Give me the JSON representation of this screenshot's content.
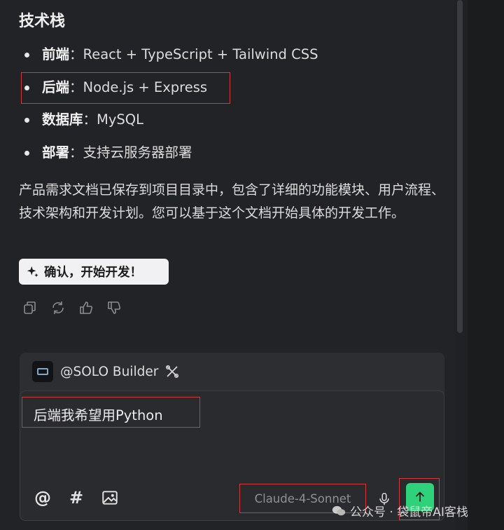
{
  "message": {
    "section_title": "技术栈",
    "tech_stack": [
      {
        "key": "前端",
        "sep": "：",
        "value": "React + TypeScript + Tailwind CSS"
      },
      {
        "key": "后端",
        "sep": "：",
        "value": "Node.js + Express"
      },
      {
        "key": "数据库",
        "sep": "：",
        "value": "MySQL"
      },
      {
        "key": "部署",
        "sep": "：",
        "value": "支持云服务器部署"
      }
    ],
    "summary": "产品需求文档已保存到项目目录中，包含了详细的功能模块、用户流程、技术架构和开发计划。您可以基于这个文档开始具体的开发工作。",
    "confirm_button": "确认，开始开发！",
    "actions": [
      "copy-icon",
      "regenerate-icon",
      "thumbs-up-icon",
      "thumbs-down-icon"
    ]
  },
  "composer": {
    "agent_name": "@SOLO Builder",
    "input_value": "后端我希望用Python",
    "icons": {
      "mention": "@",
      "hash": "#",
      "image": "image-icon"
    },
    "model": "Claude-4-Sonnet"
  },
  "watermark": {
    "text": "公众号 · 袋鼠帝AI客栈"
  },
  "colors": {
    "background": "#222326",
    "send_button": "#2fd27a",
    "highlight_box": "#d23a3a"
  }
}
